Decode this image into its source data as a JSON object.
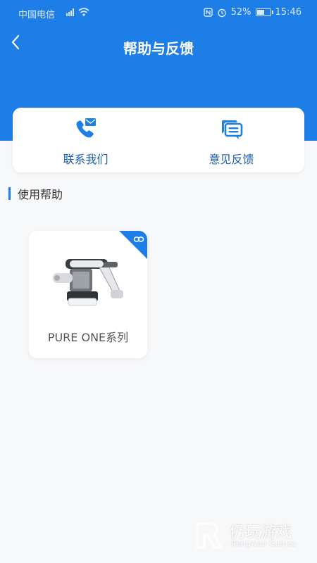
{
  "status_bar": {
    "carrier": "中国电信",
    "network": "4G",
    "battery": "52%",
    "battery_level": 0.52,
    "time": "15:46"
  },
  "header": {
    "title": "帮助与反馈"
  },
  "actions": [
    {
      "label": "联系我们",
      "icon": "phone-mail-icon"
    },
    {
      "label": "意见反馈",
      "icon": "chat-feedback-icon"
    }
  ],
  "section": {
    "title": "使用帮助"
  },
  "products": [
    {
      "name": "PURE ONE系列",
      "badge_icon": "link-icon"
    }
  ],
  "watermark": {
    "cn": "仍玩游戏",
    "en": "Rengwan Games"
  },
  "colors": {
    "primary": "#1e7ee8",
    "action_text": "#1c5fae",
    "background": "#f7f8fa"
  }
}
